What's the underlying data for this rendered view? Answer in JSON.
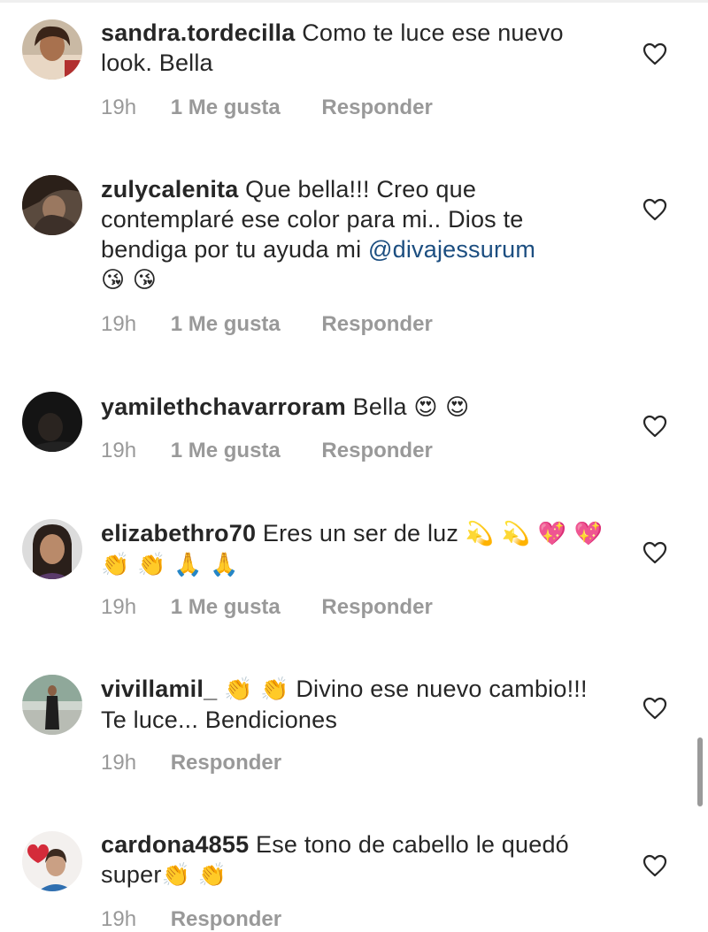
{
  "comments": [
    {
      "username": "sandra.tordecilla",
      "text": "Como te  luce ese nuevo look. Bella",
      "mention": "",
      "emojis": "",
      "time": "19h",
      "likes": "1 Me gusta",
      "reply": "Responder"
    },
    {
      "username": "zulycalenita",
      "text": "Que bella!!! Creo que contemplaré ese color para mi.. Dios te bendiga por tu ayuda mi",
      "mention": "@divajessurum",
      "emojis": "😘 😘",
      "time": "19h",
      "likes": "1 Me gusta",
      "reply": "Responder"
    },
    {
      "username": "yamilethchavarroram",
      "text": "Bella",
      "mention": "",
      "emojis": "😍 😍",
      "time": "19h",
      "likes": "1 Me gusta",
      "reply": "Responder"
    },
    {
      "username": "elizabethro70",
      "text": "Eres un ser de luz",
      "mention": "",
      "emojis": "💫 💫 💖 💖 👏 👏 🙏 🙏",
      "time": "19h",
      "likes": "1 Me gusta",
      "reply": "Responder"
    },
    {
      "username": "vivillamil_",
      "text": "Divino ese nuevo cambio!!! Te luce... Bendiciones",
      "mention": "",
      "emojis": "👏 👏",
      "time": "19h",
      "likes": "",
      "reply": "Responder"
    },
    {
      "username": "cardona4855",
      "text": "Ese tono de cabello le quedó super",
      "mention": "",
      "emojis": "👏 👏",
      "time": "19h",
      "likes": "",
      "reply": "Responder"
    }
  ],
  "icons": {
    "like": "heart-outline-icon"
  },
  "colors": {
    "text": "#262626",
    "meta": "#999999",
    "mention": "#1c4e80",
    "background": "#ffffff"
  }
}
